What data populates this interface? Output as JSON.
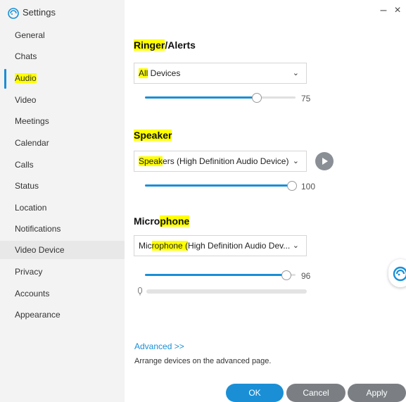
{
  "app": {
    "title": "Settings"
  },
  "window": {
    "minimize": "–",
    "close": "×"
  },
  "sidebar": {
    "items": [
      {
        "label": "General"
      },
      {
        "label": "Chats"
      },
      {
        "label": "Audio"
      },
      {
        "label": "Video"
      },
      {
        "label": "Meetings"
      },
      {
        "label": "Calendar"
      },
      {
        "label": "Calls"
      },
      {
        "label": "Status"
      },
      {
        "label": "Location"
      },
      {
        "label": "Notifications"
      },
      {
        "label": "Video Device"
      },
      {
        "label": "Privacy"
      },
      {
        "label": "Accounts"
      },
      {
        "label": "Appearance"
      }
    ],
    "active": "Audio"
  },
  "ringer": {
    "title_hl": "Ringer",
    "title_rest": "/Alerts",
    "select_hl": "All",
    "select_rest": " Devices",
    "volume": 75,
    "volume_label": "75"
  },
  "speaker": {
    "title_hl": "Speaker",
    "select_hl": "Speak",
    "select_rest": "ers (High Definition Audio Device)",
    "volume": 100,
    "volume_label": "100"
  },
  "microphone": {
    "title_pre": "Micro",
    "title_hl": "phone",
    "select_pre": "Mic",
    "select_hl": "rophone (",
    "select_rest": "High Definition Audio Dev...",
    "volume": 96,
    "volume_label": "96",
    "input_level": 0
  },
  "advanced": {
    "link": "Advanced >>",
    "description": "Arrange devices on the advanced page."
  },
  "footer": {
    "ok": "OK",
    "cancel": "Cancel",
    "apply": "Apply"
  },
  "colors": {
    "accent": "#1a8fd6",
    "highlight": "#ffff00",
    "button_gray": "#7b7f84"
  },
  "icons": [
    "app-logo-icon",
    "chevron-down-icon",
    "play-icon",
    "microphone-icon",
    "assistant-icon"
  ]
}
